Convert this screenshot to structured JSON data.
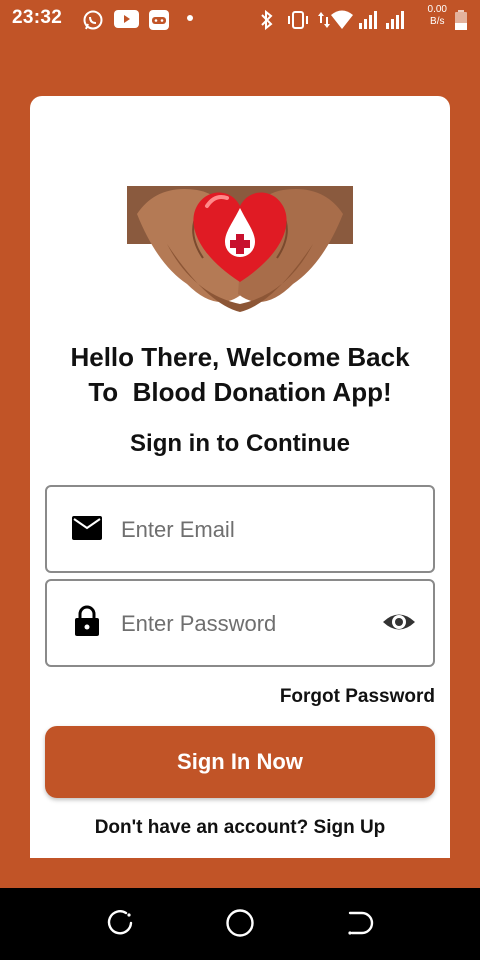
{
  "status_bar": {
    "time": "23:32",
    "net_speed_value": "0.00",
    "net_speed_unit": "B/s",
    "icons": [
      "whatsapp-icon",
      "youtube-icon",
      "game-icon",
      "dot-icon",
      "bluetooth-icon",
      "vibrate-icon",
      "data-arrows-icon",
      "wifi-icon",
      "signal-icon",
      "signal-icon",
      "battery-icon"
    ]
  },
  "colors": {
    "brand": "#c15427",
    "card": "#ffffff",
    "text": "#111111",
    "heart": "#e01b24"
  },
  "login": {
    "welcome_line1": "Hello There, Welcome Back",
    "welcome_line2": "To  Blood Donation App!",
    "subtitle": "Sign in to Continue",
    "email_placeholder": "Enter Email",
    "email_value": "",
    "password_placeholder": "Enter Password",
    "password_value": "",
    "forgot_label": "Forgot Password",
    "signin_label": "Sign In Now",
    "signup_prompt": "Don't have an account?",
    "signup_label": "Sign Up"
  },
  "nav_bar": {
    "buttons": [
      "recent-apps-icon",
      "home-icon",
      "back-icon"
    ]
  }
}
